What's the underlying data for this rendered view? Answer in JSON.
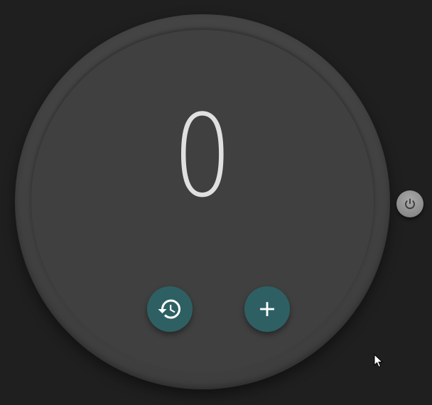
{
  "counter": {
    "value": "0"
  },
  "buttons": {
    "history_icon": "history-icon",
    "add_icon": "plus-icon",
    "power_icon": "power-icon"
  },
  "colors": {
    "background": "#1f1f1f",
    "face": "#404040",
    "accent": "#2e6063",
    "text": "#e0e0e0"
  }
}
